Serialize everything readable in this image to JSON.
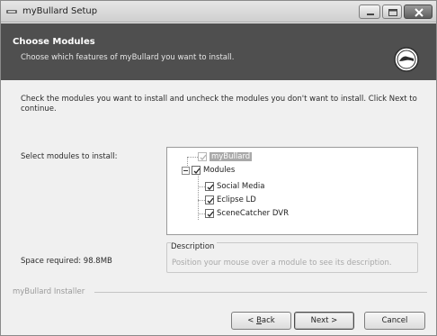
{
  "window": {
    "title": "myBullard Setup"
  },
  "header": {
    "title": "Choose Modules",
    "subtitle": "Choose which features of myBullard you want to install.",
    "logo_icon": "bullard-logo-icon"
  },
  "intro": "Check the modules you want to install and uncheck the modules you don't want to install. Click Next to continue.",
  "select_label": "Select modules to install:",
  "tree": {
    "items": [
      {
        "label": "myBullard",
        "checked": true,
        "disabled": true,
        "selected": true
      },
      {
        "label": "Modules",
        "checked": true,
        "expanded": true
      },
      {
        "label": "Social Media",
        "checked": true
      },
      {
        "label": "Eclipse LD",
        "checked": true
      },
      {
        "label": "SceneCatcher DVR",
        "checked": true
      }
    ]
  },
  "description": {
    "title": "Description",
    "text": "Position your mouse over a module to see its description."
  },
  "space_required": "Space required: 98.8MB",
  "footer": {
    "brand": "myBullard Installer",
    "back_prefix": "< ",
    "back_hotkey": "B",
    "back_rest": "ack",
    "next_label": "Next >",
    "cancel_label": "Cancel"
  },
  "colors": {
    "banner": "#4f4f4f",
    "window_bg": "#f0f0f0",
    "selection": "#a9a9a9"
  }
}
